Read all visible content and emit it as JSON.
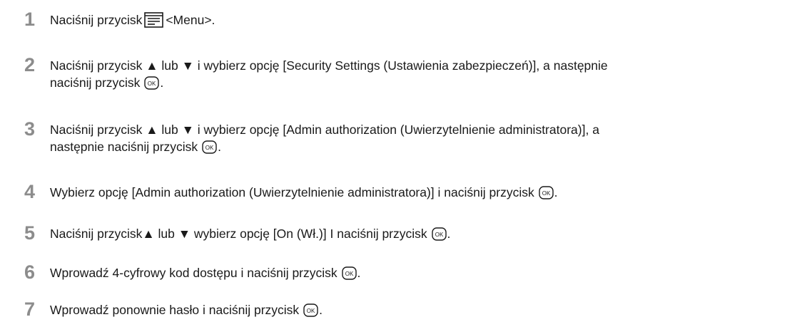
{
  "steps": [
    {
      "number": "1",
      "parts": [
        "Naciśnij przycisk",
        "<Menu>."
      ]
    },
    {
      "number": "2",
      "parts": [
        "Naciśnij przycisk ▲ lub ▼ i wybierz opcję [Security Settings (Ustawienia zabezpieczeń)], a następnie",
        "naciśnij przycisk",
        "."
      ]
    },
    {
      "number": "3",
      "parts": [
        "Naciśnij przycisk ▲ lub ▼ i wybierz opcję [Admin authorization (Uwierzytelnienie administratora)], a",
        "następnie naciśnij przycisk",
        "."
      ]
    },
    {
      "number": "4",
      "parts": [
        "Wybierz opcję [Admin authorization (Uwierzytelnienie administratora)] i naciśnij przycisk",
        "."
      ]
    },
    {
      "number": "5",
      "parts": [
        "Naciśnij przycisk▲ lub ▼ wybierz opcję [On (Wł.)] I naciśnij przycisk",
        "."
      ]
    },
    {
      "number": "6",
      "parts": [
        "Wprowadź 4-cyfrowy kod dostępu i naciśnij przycisk",
        "."
      ]
    },
    {
      "number": "7",
      "parts": [
        "Wprowadź ponownie hasło i naciśnij przycisk",
        "."
      ]
    }
  ],
  "icons": {
    "menu_button": "menu-icon",
    "ok_button": "ok-icon",
    "ok_label": "OK"
  },
  "colors": {
    "step_number": "#8c8c8c",
    "text": "#1a1a1a"
  }
}
